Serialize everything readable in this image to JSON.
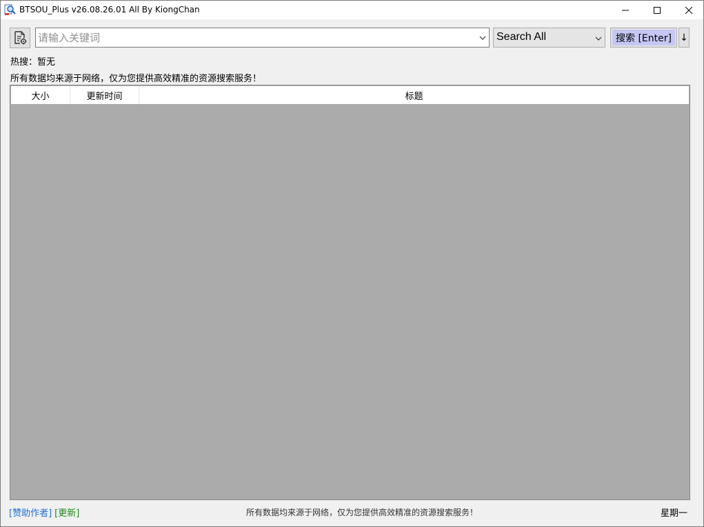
{
  "window": {
    "title": "BTSOU_Plus v26.08.26.01 All By KiongChan"
  },
  "toolbar": {
    "settings_icon": "document-settings-icon",
    "search_placeholder": "请输入关键词",
    "search_value": "",
    "scope_value": "Search All",
    "search_button_label": "搜索 [Enter]",
    "more_button_label": "↓"
  },
  "hot_search": {
    "label": "热搜：",
    "value": "暂无"
  },
  "notice": "所有数据均来源于网络，仅为您提供高效精准的资源搜索服务！",
  "results": {
    "columns": [
      "大小",
      "更新时间",
      "标题"
    ],
    "rows": []
  },
  "statusbar": {
    "donate_label": "[赞助作者]",
    "update_label": "[更新]",
    "center_text": "所有数据均来源于网络，仅为您提供高效精准的资源搜索服务！",
    "weekday": "星期一"
  },
  "colors": {
    "search_button_highlight": "#c6c6f5",
    "results_background": "#ababab",
    "donate_link": "#1e6fd8",
    "update_link": "#1a8a1a"
  }
}
